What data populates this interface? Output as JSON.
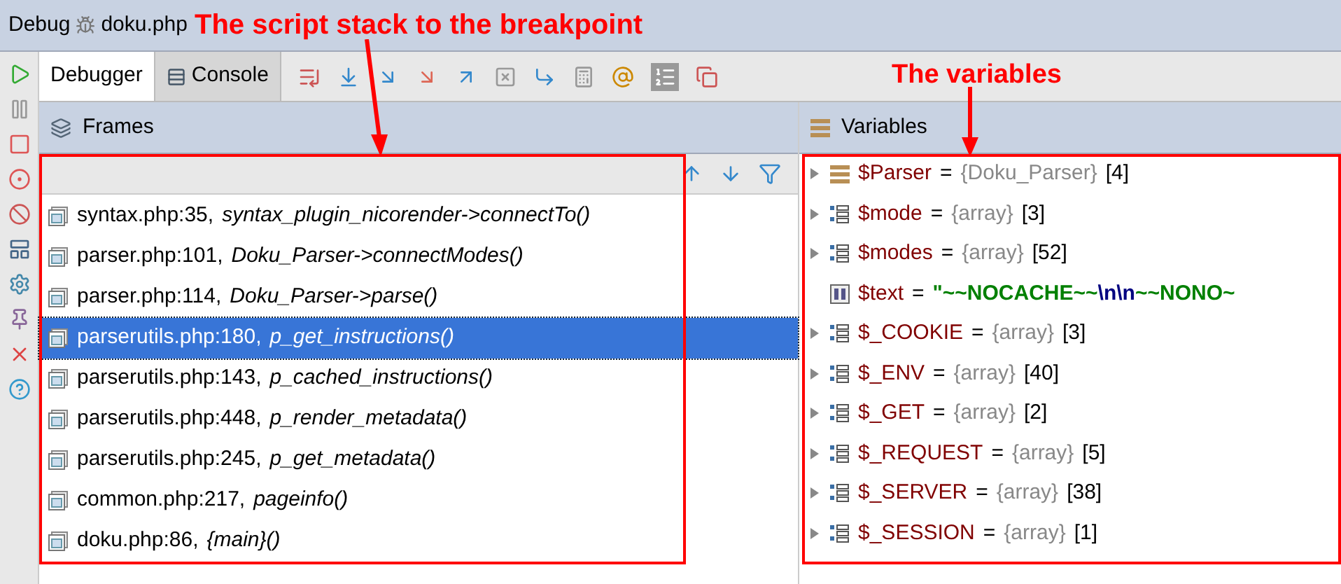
{
  "window": {
    "title": "Debug",
    "file": "doku.php"
  },
  "tabs": [
    {
      "label": "Debugger",
      "selected": true
    },
    {
      "label": "Console",
      "selected": false
    }
  ],
  "frames": {
    "title": "Frames",
    "items": [
      {
        "location": "syntax.php:35,",
        "function": "syntax_plugin_nicorender->connectTo()",
        "selected": false
      },
      {
        "location": "parser.php:101,",
        "function": "Doku_Parser->connectModes()",
        "selected": false
      },
      {
        "location": "parser.php:114,",
        "function": "Doku_Parser->parse()",
        "selected": false
      },
      {
        "location": "parserutils.php:180,",
        "function": "p_get_instructions()",
        "selected": true
      },
      {
        "location": "parserutils.php:143,",
        "function": "p_cached_instructions()",
        "selected": false
      },
      {
        "location": "parserutils.php:448,",
        "function": "p_render_metadata()",
        "selected": false
      },
      {
        "location": "parserutils.php:245,",
        "function": "p_get_metadata()",
        "selected": false
      },
      {
        "location": "common.php:217,",
        "function": "pageinfo()",
        "selected": false
      },
      {
        "location": "doku.php:86,",
        "function": "{main}()",
        "selected": false
      }
    ]
  },
  "variables": {
    "title": "Variables",
    "operator": "=",
    "items": [
      {
        "kind": "object",
        "name": "$Parser",
        "type": "{Doku_Parser}",
        "count": "[4]"
      },
      {
        "kind": "array",
        "name": "$mode",
        "type": "{array}",
        "count": "[3]"
      },
      {
        "kind": "array",
        "name": "$modes",
        "type": "{array}",
        "count": "[52]"
      },
      {
        "kind": "string",
        "name": "$text",
        "parts": [
          {
            "kind": "string",
            "text": "\"~~NOCACHE~~"
          },
          {
            "kind": "escape",
            "text": "\\n\\n"
          },
          {
            "kind": "string",
            "text": "~~NONO~"
          }
        ]
      },
      {
        "kind": "array",
        "name": "$_COOKIE",
        "type": "{array}",
        "count": "[3]"
      },
      {
        "kind": "array",
        "name": "$_ENV",
        "type": "{array}",
        "count": "[40]"
      },
      {
        "kind": "array",
        "name": "$_GET",
        "type": "{array}",
        "count": "[2]"
      },
      {
        "kind": "array",
        "name": "$_REQUEST",
        "type": "{array}",
        "count": "[5]"
      },
      {
        "kind": "array",
        "name": "$_SERVER",
        "type": "{array}",
        "count": "[38]"
      },
      {
        "kind": "array",
        "name": "$_SESSION",
        "type": "{array}",
        "count": "[1]"
      }
    ]
  },
  "annotations": [
    {
      "kind": "frames",
      "text": "The script stack to the breakpoint"
    },
    {
      "kind": "variables",
      "text": "The variables"
    }
  ]
}
